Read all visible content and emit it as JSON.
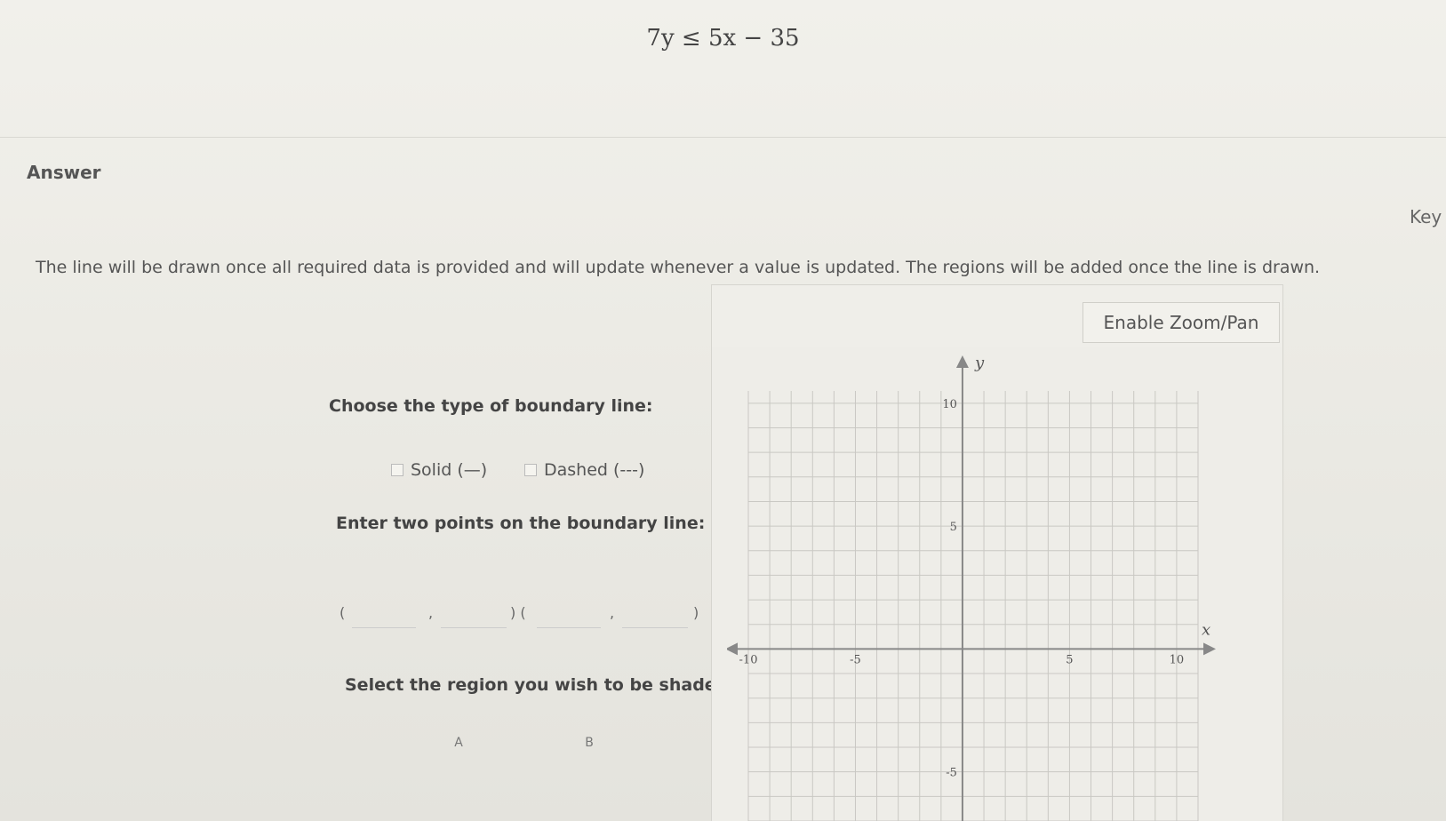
{
  "problem": {
    "equation": "7y ≤ 5x − 35"
  },
  "answer_label": "Answer",
  "key_label": "Key",
  "instructions": "The line will be drawn once all required data is provided and will update whenever a value is updated. The regions will be added once the line is drawn.",
  "zoom_button": "Enable Zoom/Pan",
  "boundary": {
    "question": "Choose the type of boundary line:",
    "solid_label": "Solid (—)",
    "dashed_label": "Dashed (---)"
  },
  "points": {
    "question": "Enter two points on the boundary line:",
    "open_paren": "(",
    "comma": ",",
    "mid_parens": ") (",
    "close_paren": ")",
    "p1x": "",
    "p1y": "",
    "p2x": "",
    "p2y": ""
  },
  "region": {
    "question": "Select the region you wish to be shaded:",
    "option_a": "A",
    "option_b": "B"
  },
  "graph": {
    "x_label": "x",
    "y_label": "y",
    "x_ticks": [
      "-10",
      "-5",
      "5",
      "10"
    ],
    "y_ticks": [
      "10",
      "5",
      "-5"
    ],
    "x_range": [
      -10,
      11
    ],
    "y_range": [
      -7,
      10.5
    ],
    "grid_step": 1
  }
}
